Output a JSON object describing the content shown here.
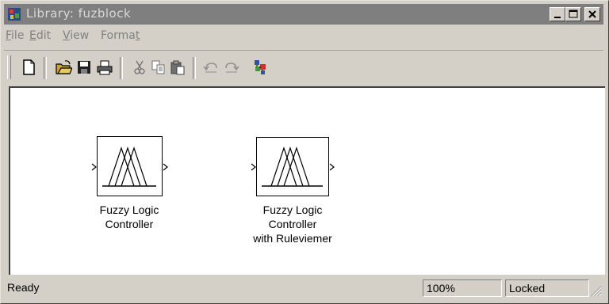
{
  "window": {
    "title": "Library: fuzblock",
    "icon": "simulink-library-icon",
    "controls": [
      "minimize-icon",
      "maximize-icon",
      "close-icon"
    ]
  },
  "menu": [
    {
      "label": "File",
      "mnemonic": "F",
      "rest": "ile"
    },
    {
      "label": "Edit",
      "mnemonic": "E",
      "rest": "dit"
    },
    {
      "label": "View",
      "mnemonic": "V",
      "rest": "iew"
    },
    {
      "label": "Format",
      "pre": "Forma",
      "mnemonic": "t"
    }
  ],
  "toolbar": {
    "buttons": [
      "new-icon",
      "open-icon",
      "save-icon",
      "print-icon",
      "cut-icon",
      "copy-icon",
      "paste-icon",
      "undo-icon",
      "redo-icon",
      "library-browser-icon"
    ]
  },
  "blocks": [
    {
      "label_line1": "Fuzzy Logic",
      "label_line2": "Controller",
      "label_line3": ""
    },
    {
      "label_line1": "Fuzzy Logic",
      "label_line2": "Controller",
      "label_line3": "with Ruleviemer"
    }
  ],
  "status": {
    "text": "Ready",
    "zoom": "100%",
    "lock": "Locked"
  },
  "colors": {
    "titlebar_inactive": "#7f7f7f",
    "face": "#d4d0c8",
    "canvas": "#ffffff"
  }
}
